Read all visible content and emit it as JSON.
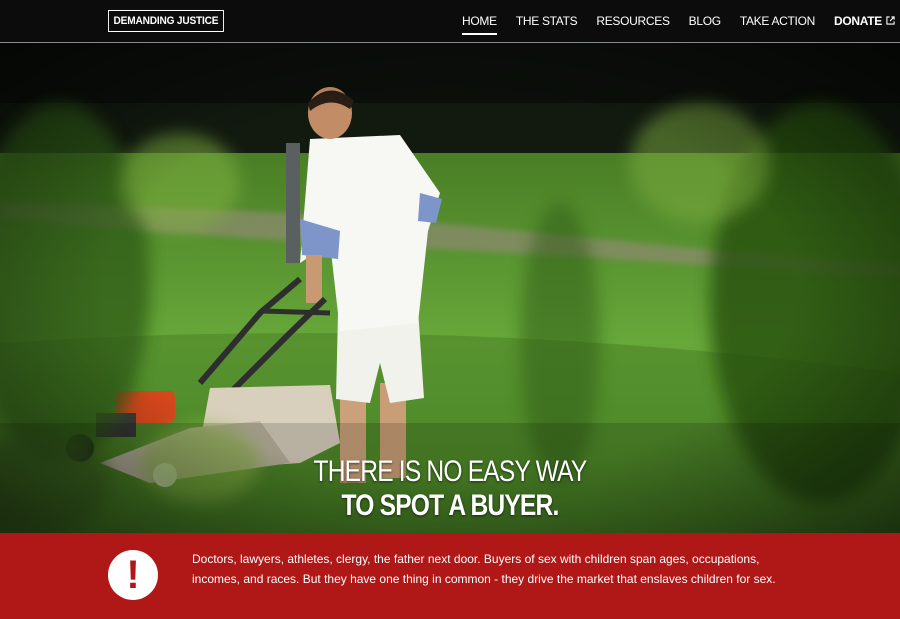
{
  "header": {
    "logo": "DEMANDING JUSTICE",
    "nav": [
      {
        "label": "HOME",
        "active": true
      },
      {
        "label": "THE STATS"
      },
      {
        "label": "RESOURCES"
      },
      {
        "label": "BLOG"
      },
      {
        "label": "TAKE ACTION"
      },
      {
        "label": "DONATE",
        "icon": "external-link-icon"
      }
    ]
  },
  "hero": {
    "headline_line1": "THERE IS NO EASY WAY",
    "headline_line2": "TO SPOT A BUYER."
  },
  "alert": {
    "icon": "exclamation-icon",
    "icon_glyph": "!",
    "text": "Doctors, lawyers, athletes, clergy, the father next door. Buyers of sex with children span ages, occupations, incomes, and races. But they have one thing in common - they drive the market that enslaves children for sex."
  },
  "colors": {
    "accent": "#b01717",
    "header_bg": "#0c0c0c"
  }
}
